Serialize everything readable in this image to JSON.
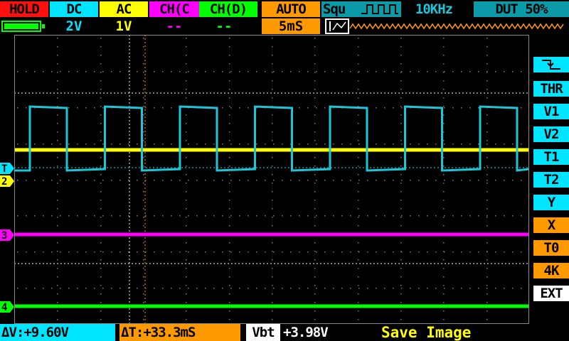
{
  "top_bar": {
    "hold": "HOLD",
    "coupling_a": "DC",
    "coupling_b": "AC",
    "ch_c": "CH(C",
    "ch_d": "CH(D)",
    "trigger_mode": "AUTO",
    "wave": "Squ",
    "frequency": "10KHz",
    "duty": "DUT 50%"
  },
  "second_row": {
    "volt_a": "2V",
    "volt_b": "1V",
    "volt_c": "--",
    "volt_d": "--",
    "timebase": "5mS"
  },
  "channel_markers": {
    "trigger": "T",
    "ch2": "2",
    "ch3": "3",
    "ch4": "4"
  },
  "side_menu": [
    "THR",
    "V1",
    "V2",
    "T1",
    "T2",
    "Y",
    "X",
    "T0",
    "4K",
    "EXT"
  ],
  "bottom_bar": {
    "dv_label": "ΔV:+9.60V",
    "dt_label": "ΔT:+33.3mS",
    "vbt_tag": "Vbt",
    "vbt_value": "+3.98V",
    "save": "Save Image"
  },
  "colors": {
    "cyan": "#00e5ff",
    "yellow": "#ffff00",
    "magenta": "#ff00ff",
    "green": "#00ff00",
    "orange": "#ff9900",
    "red": "#ff1010",
    "teal_wave": "#1ac6d8"
  },
  "icons": [
    "battery-icon",
    "square-wave-icon",
    "falling-edge-icon",
    "wave-thumbnail-icon"
  ]
}
